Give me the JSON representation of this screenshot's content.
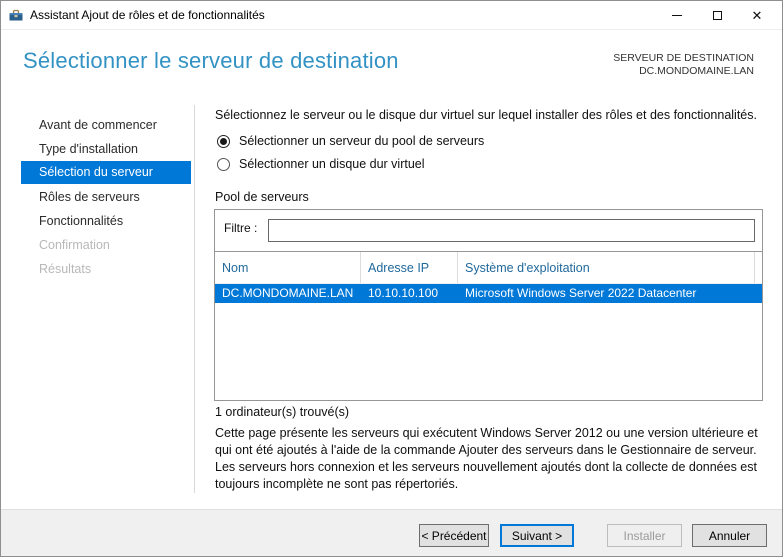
{
  "colors": {
    "accent": "#0078d7",
    "title-color": "#3392c4",
    "header-text": "#21699c"
  },
  "window": {
    "title": "Assistant Ajout de rôles et de fonctionnalités",
    "controls": {
      "minimize": "minimize",
      "maximize": "maximize",
      "close": "close"
    }
  },
  "header": {
    "title": "Sélectionner le serveur de destination",
    "destination_label": "SERVEUR DE DESTINATION",
    "destination_value": "DC.MONDOMAINE.LAN"
  },
  "sidebar": {
    "items": [
      {
        "label": "Avant de commencer",
        "state": "normal"
      },
      {
        "label": "Type d'installation",
        "state": "normal"
      },
      {
        "label": "Sélection du serveur",
        "state": "selected"
      },
      {
        "label": "Rôles de serveurs",
        "state": "normal"
      },
      {
        "label": "Fonctionnalités",
        "state": "normal"
      },
      {
        "label": "Confirmation",
        "state": "disabled"
      },
      {
        "label": "Résultats",
        "state": "disabled"
      }
    ]
  },
  "main": {
    "description": "Sélectionnez le serveur ou le disque dur virtuel sur lequel installer des rôles et des fonctionnalités.",
    "radio_pool_label": "Sélectionner un serveur du pool de serveurs",
    "radio_pool_checked": true,
    "radio_vhd_label": "Sélectionner un disque dur virtuel",
    "radio_vhd_checked": false,
    "pool": {
      "title": "Pool de serveurs",
      "filter_label": "Filtre :",
      "filter_value": "",
      "table": {
        "columns": [
          "Nom",
          "Adresse IP",
          "Système d'exploitation"
        ],
        "rows": [
          [
            "DC.MONDOMAINE.LAN",
            "10.10.10.100",
            "Microsoft Windows Server 2022 Datacenter"
          ]
        ],
        "selected_row_index": 0
      }
    },
    "count_text": "1 ordinateur(s) trouvé(s)",
    "note": "Cette page présente les serveurs qui exécutent Windows Server 2012 ou une version ultérieure et qui ont été ajoutés à l'aide de la commande Ajouter des serveurs dans le Gestionnaire de serveur. Les serveurs hors connexion et les serveurs nouvellement ajoutés dont la collecte de données est toujours incomplète ne sont pas répertoriés."
  },
  "footer": {
    "back_label": "< Précédent",
    "next_label": "Suivant >",
    "install_label": "Installer",
    "cancel_label": "Annuler"
  }
}
